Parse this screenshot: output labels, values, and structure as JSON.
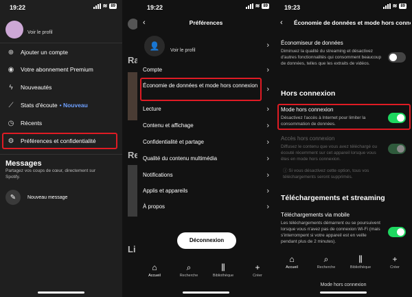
{
  "screen1": {
    "status": {
      "time": "19:22",
      "battery": "89"
    },
    "profile_label": "Voir le profil",
    "menu": [
      {
        "icon": "plus-circle-icon",
        "glyph": "⊕",
        "label": "Ajouter un compte"
      },
      {
        "icon": "spotify-icon",
        "glyph": "◉",
        "label": "Votre abonnement Premium"
      },
      {
        "icon": "lightning-icon",
        "glyph": "ϟ",
        "label": "Nouveautés"
      },
      {
        "icon": "stats-icon",
        "glyph": "📈",
        "label": "Stats d'écoute",
        "badge": "• Nouveau"
      },
      {
        "icon": "clock-icon",
        "glyph": "◷",
        "label": "Récents"
      },
      {
        "icon": "gear-icon",
        "glyph": "⚙",
        "label": "Préférences et confidentialité"
      }
    ],
    "messages": {
      "heading": "Messages",
      "desc": "Partagez vos coups de cœur, directement sur Spotify.",
      "new_message": "Nouveau message"
    },
    "peek": {
      "ra": "Ra",
      "re": "Re",
      "li": "Li"
    }
  },
  "screen2": {
    "status": {
      "time": "19:22",
      "battery": "89"
    },
    "title": "Préférences",
    "profile_label": "Voir le profil",
    "items": [
      "Compte",
      "Économie de données et mode hors connexion",
      "Lecture",
      "Contenu et affichage",
      "Confidentialité et partage",
      "Qualité du contenu multimédia",
      "Notifications",
      "Applis et appareils",
      "À propos"
    ],
    "logout": "Déconnexion",
    "nav": [
      {
        "icon": "home-icon",
        "label": "Accueil"
      },
      {
        "icon": "search-icon",
        "label": "Recherche"
      },
      {
        "icon": "library-icon",
        "label": "Bibliothèque"
      },
      {
        "icon": "plus-icon",
        "label": "Créer"
      }
    ]
  },
  "screen3": {
    "status": {
      "time": "19:23",
      "battery": "89"
    },
    "title": "Économie de données et mode hors connexion",
    "data_saver": {
      "title": "Économiseur de données",
      "desc": "Diminuez la qualité du streaming et désactivez d'autres fonctionnalités qui consomment beaucoup de données, telles que les extraits de vidéos.",
      "enabled": false
    },
    "offline_heading": "Hors connexion",
    "offline_mode": {
      "title": "Mode hors connexion",
      "desc": "Désactivez l'accès à Internet pour limiter la consommation de données.",
      "enabled": true
    },
    "offline_access": {
      "title": "Accès hors connexion",
      "desc": "Diffusez le contenu que vous avez téléchargé ou écouté récemment sur cet appareil lorsque vous êtes en mode hors connexion.",
      "note": "ⓘ Si vous désactivez cette option, tous vos téléchargements seront supprimés.",
      "enabled": true
    },
    "downloads_heading": "Téléchargements et streaming",
    "mobile_downloads": {
      "title": "Téléchargements via mobile",
      "desc": "Les téléchargements démarrent ou se poursuivent lorsque vous n'avez pas de connexion Wi-Fi (mais s'interrompent si votre appareil est en veille pendant plus de 2 minutes).",
      "enabled": true
    },
    "nav": [
      {
        "icon": "home-icon",
        "label": "Accueil"
      },
      {
        "icon": "search-icon",
        "label": "Recherche"
      },
      {
        "icon": "library-icon",
        "label": "Bibliothèque"
      },
      {
        "icon": "plus-icon",
        "label": "Créer"
      }
    ],
    "caption": "Mode hors connexion"
  }
}
